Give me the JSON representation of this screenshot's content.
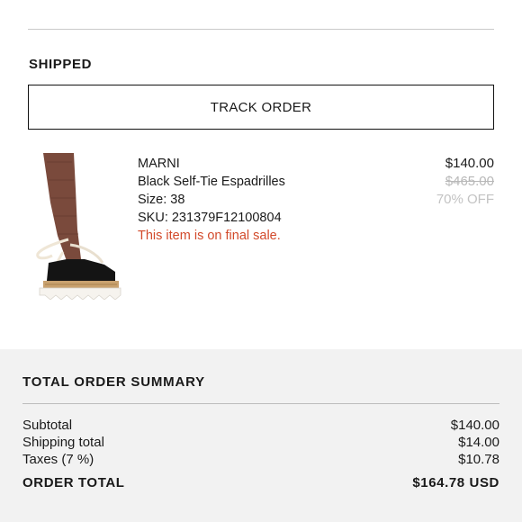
{
  "order": {
    "status": "SHIPPED",
    "track_button_label": "TRACK ORDER"
  },
  "item": {
    "image_icon": "black-self-tie-espadrille-image",
    "brand": "MARNI",
    "name": "Black Self-Tie Espadrilles",
    "size": "Size: 38",
    "sku": "SKU: 231379F12100804",
    "final_sale_note": "This item is on final sale.",
    "price": "$140.00",
    "original_price": "$465.00",
    "discount": "70% OFF"
  },
  "summary": {
    "title": "TOTAL ORDER SUMMARY",
    "subtotal_label": "Subtotal",
    "subtotal_value": "$140.00",
    "shipping_label": "Shipping total",
    "shipping_value": "$14.00",
    "taxes_label": "Taxes (7 %)",
    "taxes_value": "$10.78",
    "total_label": "ORDER TOTAL",
    "total_value": "$164.78 USD"
  },
  "colors": {
    "final_sale": "#d24a2b",
    "summary_background": "#f2f2f2"
  }
}
